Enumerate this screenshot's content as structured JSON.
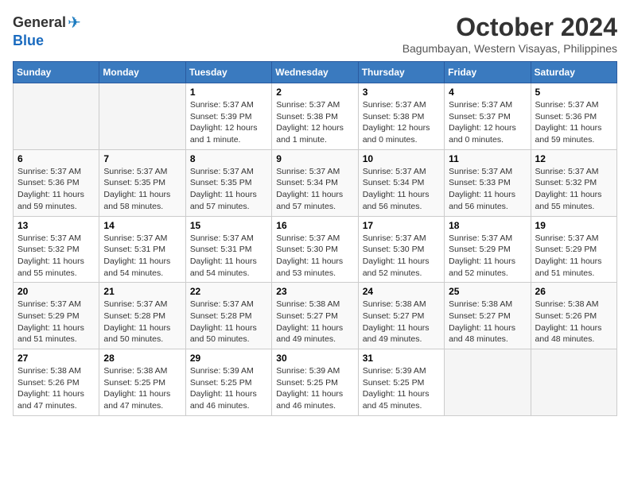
{
  "logo": {
    "general": "General",
    "blue": "Blue"
  },
  "title": {
    "month": "October 2024",
    "location": "Bagumbayan, Western Visayas, Philippines"
  },
  "headers": [
    "Sunday",
    "Monday",
    "Tuesday",
    "Wednesday",
    "Thursday",
    "Friday",
    "Saturday"
  ],
  "weeks": [
    [
      {
        "day": "",
        "detail": ""
      },
      {
        "day": "",
        "detail": ""
      },
      {
        "day": "1",
        "detail": "Sunrise: 5:37 AM\nSunset: 5:39 PM\nDaylight: 12 hours\nand 1 minute."
      },
      {
        "day": "2",
        "detail": "Sunrise: 5:37 AM\nSunset: 5:38 PM\nDaylight: 12 hours\nand 1 minute."
      },
      {
        "day": "3",
        "detail": "Sunrise: 5:37 AM\nSunset: 5:38 PM\nDaylight: 12 hours\nand 0 minutes."
      },
      {
        "day": "4",
        "detail": "Sunrise: 5:37 AM\nSunset: 5:37 PM\nDaylight: 12 hours\nand 0 minutes."
      },
      {
        "day": "5",
        "detail": "Sunrise: 5:37 AM\nSunset: 5:36 PM\nDaylight: 11 hours\nand 59 minutes."
      }
    ],
    [
      {
        "day": "6",
        "detail": "Sunrise: 5:37 AM\nSunset: 5:36 PM\nDaylight: 11 hours\nand 59 minutes."
      },
      {
        "day": "7",
        "detail": "Sunrise: 5:37 AM\nSunset: 5:35 PM\nDaylight: 11 hours\nand 58 minutes."
      },
      {
        "day": "8",
        "detail": "Sunrise: 5:37 AM\nSunset: 5:35 PM\nDaylight: 11 hours\nand 57 minutes."
      },
      {
        "day": "9",
        "detail": "Sunrise: 5:37 AM\nSunset: 5:34 PM\nDaylight: 11 hours\nand 57 minutes."
      },
      {
        "day": "10",
        "detail": "Sunrise: 5:37 AM\nSunset: 5:34 PM\nDaylight: 11 hours\nand 56 minutes."
      },
      {
        "day": "11",
        "detail": "Sunrise: 5:37 AM\nSunset: 5:33 PM\nDaylight: 11 hours\nand 56 minutes."
      },
      {
        "day": "12",
        "detail": "Sunrise: 5:37 AM\nSunset: 5:32 PM\nDaylight: 11 hours\nand 55 minutes."
      }
    ],
    [
      {
        "day": "13",
        "detail": "Sunrise: 5:37 AM\nSunset: 5:32 PM\nDaylight: 11 hours\nand 55 minutes."
      },
      {
        "day": "14",
        "detail": "Sunrise: 5:37 AM\nSunset: 5:31 PM\nDaylight: 11 hours\nand 54 minutes."
      },
      {
        "day": "15",
        "detail": "Sunrise: 5:37 AM\nSunset: 5:31 PM\nDaylight: 11 hours\nand 54 minutes."
      },
      {
        "day": "16",
        "detail": "Sunrise: 5:37 AM\nSunset: 5:30 PM\nDaylight: 11 hours\nand 53 minutes."
      },
      {
        "day": "17",
        "detail": "Sunrise: 5:37 AM\nSunset: 5:30 PM\nDaylight: 11 hours\nand 52 minutes."
      },
      {
        "day": "18",
        "detail": "Sunrise: 5:37 AM\nSunset: 5:29 PM\nDaylight: 11 hours\nand 52 minutes."
      },
      {
        "day": "19",
        "detail": "Sunrise: 5:37 AM\nSunset: 5:29 PM\nDaylight: 11 hours\nand 51 minutes."
      }
    ],
    [
      {
        "day": "20",
        "detail": "Sunrise: 5:37 AM\nSunset: 5:29 PM\nDaylight: 11 hours\nand 51 minutes."
      },
      {
        "day": "21",
        "detail": "Sunrise: 5:37 AM\nSunset: 5:28 PM\nDaylight: 11 hours\nand 50 minutes."
      },
      {
        "day": "22",
        "detail": "Sunrise: 5:37 AM\nSunset: 5:28 PM\nDaylight: 11 hours\nand 50 minutes."
      },
      {
        "day": "23",
        "detail": "Sunrise: 5:38 AM\nSunset: 5:27 PM\nDaylight: 11 hours\nand 49 minutes."
      },
      {
        "day": "24",
        "detail": "Sunrise: 5:38 AM\nSunset: 5:27 PM\nDaylight: 11 hours\nand 49 minutes."
      },
      {
        "day": "25",
        "detail": "Sunrise: 5:38 AM\nSunset: 5:27 PM\nDaylight: 11 hours\nand 48 minutes."
      },
      {
        "day": "26",
        "detail": "Sunrise: 5:38 AM\nSunset: 5:26 PM\nDaylight: 11 hours\nand 48 minutes."
      }
    ],
    [
      {
        "day": "27",
        "detail": "Sunrise: 5:38 AM\nSunset: 5:26 PM\nDaylight: 11 hours\nand 47 minutes."
      },
      {
        "day": "28",
        "detail": "Sunrise: 5:38 AM\nSunset: 5:25 PM\nDaylight: 11 hours\nand 47 minutes."
      },
      {
        "day": "29",
        "detail": "Sunrise: 5:39 AM\nSunset: 5:25 PM\nDaylight: 11 hours\nand 46 minutes."
      },
      {
        "day": "30",
        "detail": "Sunrise: 5:39 AM\nSunset: 5:25 PM\nDaylight: 11 hours\nand 46 minutes."
      },
      {
        "day": "31",
        "detail": "Sunrise: 5:39 AM\nSunset: 5:25 PM\nDaylight: 11 hours\nand 45 minutes."
      },
      {
        "day": "",
        "detail": ""
      },
      {
        "day": "",
        "detail": ""
      }
    ]
  ]
}
